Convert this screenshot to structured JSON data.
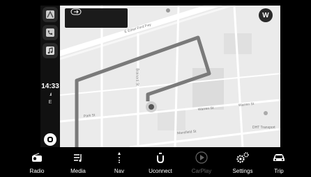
{
  "status": {
    "time": "14:33",
    "signal": ".ııl",
    "network": "E"
  },
  "dock": {
    "apps": [
      {
        "icon": "maps-app-icon"
      },
      {
        "icon": "phone-app-icon"
      },
      {
        "icon": "music-app-icon"
      }
    ],
    "home_icon": "home-button-icon"
  },
  "map": {
    "streets": {
      "e_edsel_ford_fwy": "E Edsel Ford Fwy",
      "vertical_street": "Brainard St",
      "park_st": "Park St",
      "warren_st": "Warren St",
      "lower_street": "Mansfield St",
      "right_street": "Warren St",
      "dht": "DHT Transport"
    },
    "route_color": "#7a7a7a",
    "nav_card_icon": "exit-turn-icon",
    "user_initial": "W"
  },
  "bottom_bar": {
    "items": [
      {
        "label": "Radio",
        "icon": "radio-icon"
      },
      {
        "label": "Media",
        "icon": "media-icon"
      },
      {
        "label": "Nav",
        "icon": "nav-icon"
      },
      {
        "label": "Uconnect",
        "icon": "uconnect-icon"
      },
      {
        "label": "CarPlay",
        "icon": "carplay-icon",
        "disabled": true
      },
      {
        "label": "Settings",
        "icon": "settings-icon"
      },
      {
        "label": "Trip",
        "icon": "trip-icon"
      }
    ]
  }
}
